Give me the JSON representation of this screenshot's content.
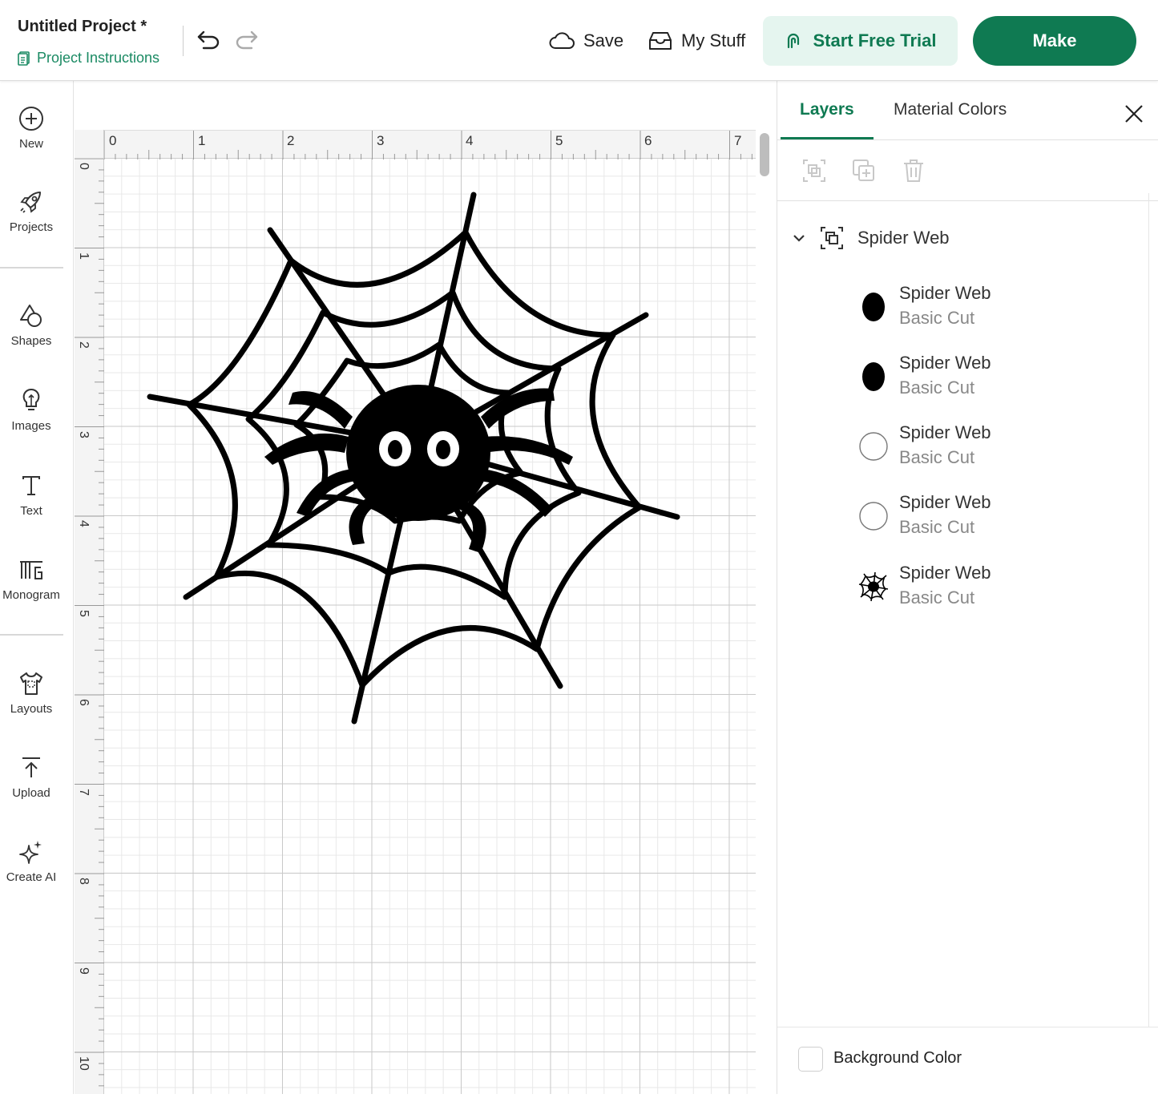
{
  "header": {
    "project_title": "Untitled Project *",
    "project_instructions": "Project Instructions",
    "save_label": "Save",
    "mystuff_label": "My Stuff",
    "trial_label": "Start Free Trial",
    "make_label": "Make"
  },
  "sidebar": {
    "items": [
      {
        "label": "New",
        "icon": "plus-circle-icon"
      },
      {
        "label": "Projects",
        "icon": "rocket-icon"
      },
      {
        "label": "Shapes",
        "icon": "shapes-icon"
      },
      {
        "label": "Images",
        "icon": "lightbulb-icon"
      },
      {
        "label": "Text",
        "icon": "text-icon"
      },
      {
        "label": "Monogram",
        "icon": "monogram-icon"
      },
      {
        "label": "Layouts",
        "icon": "shirt-icon"
      },
      {
        "label": "Upload",
        "icon": "upload-icon"
      },
      {
        "label": "Create AI",
        "icon": "sparkle-icon"
      }
    ]
  },
  "canvas": {
    "ruler_x": [
      "0",
      "1",
      "2",
      "3",
      "4",
      "5",
      "6",
      "7"
    ],
    "ruler_y": [
      "0",
      "1",
      "2",
      "3",
      "4",
      "5",
      "6",
      "7",
      "8",
      "9",
      "10"
    ]
  },
  "panel": {
    "tab_layers": "Layers",
    "tab_colors": "Material Colors",
    "group_name": "Spider Web",
    "layers": [
      {
        "name": "Spider Web",
        "op": "Basic Cut",
        "swatch": "#000000"
      },
      {
        "name": "Spider Web",
        "op": "Basic Cut",
        "swatch": "#000000"
      },
      {
        "name": "Spider Web",
        "op": "Basic Cut",
        "swatch": "#ffffff"
      },
      {
        "name": "Spider Web",
        "op": "Basic Cut",
        "swatch": "#ffffff"
      },
      {
        "name": "Spider Web",
        "op": "Basic Cut",
        "swatch": "spider-web-thumbnail"
      }
    ],
    "background_color_label": "Background Color"
  },
  "colors": {
    "brand_green": "#0f7a52",
    "trial_bg": "#e5f5ef"
  }
}
